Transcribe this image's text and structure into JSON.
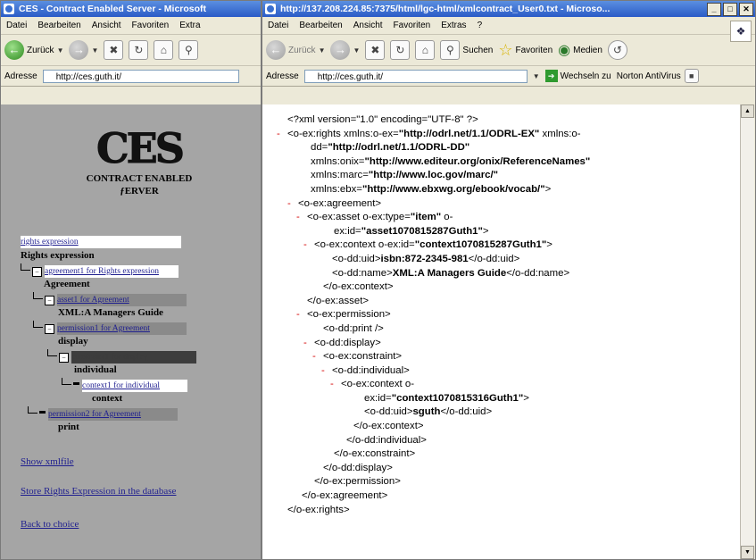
{
  "left_window": {
    "title": "CES - Contract Enabled Server - Microsoft",
    "menu": [
      "Datei",
      "Bearbeiten",
      "Ansicht",
      "Favoriten",
      "Extra"
    ],
    "back_label": "Zurück",
    "address_label": "Adresse",
    "address_value": "http://ces.guth.it/"
  },
  "right_window": {
    "title": "http://137.208.224.85:7375/html/lgc-html/xmlcontract_User0.txt - Microso...",
    "menu": [
      "Datei",
      "Bearbeiten",
      "Ansicht",
      "Favoriten",
      "Extras",
      "?"
    ],
    "back_label": "Zurück",
    "search_label": "Suchen",
    "favorites_label": "Favoriten",
    "media_label": "Medien",
    "address_label": "Adresse",
    "address_value": "http://ces.guth.it/",
    "go_label": "Wechseln zu",
    "norton_label": "Norton AntiVirus"
  },
  "logo": {
    "mark": "CES",
    "line1": "CONTRACT ENABLED",
    "line2": "ƒERVER"
  },
  "tree": {
    "rights_expression_link": "rights expression",
    "rights_expression_heading": "Rights expression",
    "agreement_link": "agreement1 for Rights expression",
    "agreement_label": "Agreement",
    "asset_link": "asset1 for Agreement",
    "asset_label": "XML:A Managers Guide",
    "permission1_link": "permission1 for Agreement",
    "display_label": "display",
    "constraint_link": "constraint1 for display",
    "individual_label": "individual",
    "context_link": "context1 for individual",
    "context_label": "context",
    "permission2_link": "permission2 for Agreement",
    "print_label": "print"
  },
  "links": {
    "show_xml": "Show xmlfile",
    "store": "Store Rights Expression in the database",
    "back": "Back to choice"
  },
  "xml_lines": [
    {
      "pm": "",
      "a": "<?xml version=\"1.0\" encoding=\"UTF-8\" ?>",
      "b": "",
      "c": ""
    },
    {
      "pm": "-",
      "a": "<o-ex:rights xmlns:o-ex=",
      "b": "\"http://odrl.net/1.1/ODRL-EX\"",
      "c": " xmlns:o-"
    },
    {
      "pm": "",
      "a": "dd=",
      "b": "\"http://odrl.net/1.1/ODRL-DD\"",
      "c": ""
    },
    {
      "pm": "",
      "a": "xmlns:onix=",
      "b": "\"http://www.editeur.org/onix/ReferenceNames\"",
      "c": ""
    },
    {
      "pm": "",
      "a": "xmlns:marc=",
      "b": "\"http://www.loc.gov/marc/\"",
      "c": ""
    },
    {
      "pm": "",
      "a": "xmlns:ebx=",
      "b": "\"http://www.ebxwg.org/ebook/vocab/\"",
      "c": ">"
    },
    {
      "pm": "-",
      "a": "<o-ex:agreement>",
      "b": "",
      "c": ""
    },
    {
      "pm": "-",
      "a": "<o-ex:asset o-ex:type=",
      "b": "\"item\"",
      "c": " o-"
    },
    {
      "pm": "",
      "a": "ex:id=",
      "b": "\"asset1070815287Guth1\"",
      "c": ">"
    },
    {
      "pm": "-",
      "a": "<o-ex:context o-ex:id=",
      "b": "\"context1070815287Guth1\"",
      "c": ">"
    },
    {
      "pm": "",
      "a": "<o-dd:uid>",
      "b": "isbn:872-2345-981",
      "c": "</o-dd:uid>"
    },
    {
      "pm": "",
      "a": "<o-dd:name>",
      "b": "XML:A Managers Guide",
      "c": "</o-dd:name>"
    },
    {
      "pm": "",
      "a": "</o-ex:context>",
      "b": "",
      "c": ""
    },
    {
      "pm": "",
      "a": "</o-ex:asset>",
      "b": "",
      "c": ""
    },
    {
      "pm": "-",
      "a": "<o-ex:permission>",
      "b": "",
      "c": ""
    },
    {
      "pm": "",
      "a": "<o-dd:print />",
      "b": "",
      "c": ""
    },
    {
      "pm": "-",
      "a": "<o-dd:display>",
      "b": "",
      "c": ""
    },
    {
      "pm": "-",
      "a": "<o-ex:constraint>",
      "b": "",
      "c": ""
    },
    {
      "pm": "-",
      "a": "<o-dd:individual>",
      "b": "",
      "c": ""
    },
    {
      "pm": "-",
      "a": "<o-ex:context o-",
      "b": "",
      "c": ""
    },
    {
      "pm": "",
      "a": "ex:id=",
      "b": "\"context1070815316Guth1\"",
      "c": ">"
    },
    {
      "pm": "",
      "a": "<o-dd:uid>",
      "b": "sguth",
      "c": "</o-dd:uid>"
    },
    {
      "pm": "",
      "a": "</o-ex:context>",
      "b": "",
      "c": ""
    },
    {
      "pm": "",
      "a": "</o-dd:individual>",
      "b": "",
      "c": ""
    },
    {
      "pm": "",
      "a": "</o-ex:constraint>",
      "b": "",
      "c": ""
    },
    {
      "pm": "",
      "a": "</o-dd:display>",
      "b": "",
      "c": ""
    },
    {
      "pm": "",
      "a": "</o-ex:permission>",
      "b": "",
      "c": ""
    },
    {
      "pm": "",
      "a": "</o-ex:agreement>",
      "b": "",
      "c": ""
    },
    {
      "pm": "",
      "a": "</o-ex:rights>",
      "b": "",
      "c": ""
    }
  ],
  "colors": {
    "title_bar": "#2a5bc7",
    "left_background": "#a5a5a5",
    "link": "#1f1f8f",
    "xml_collapse_marker": "#d40000"
  }
}
